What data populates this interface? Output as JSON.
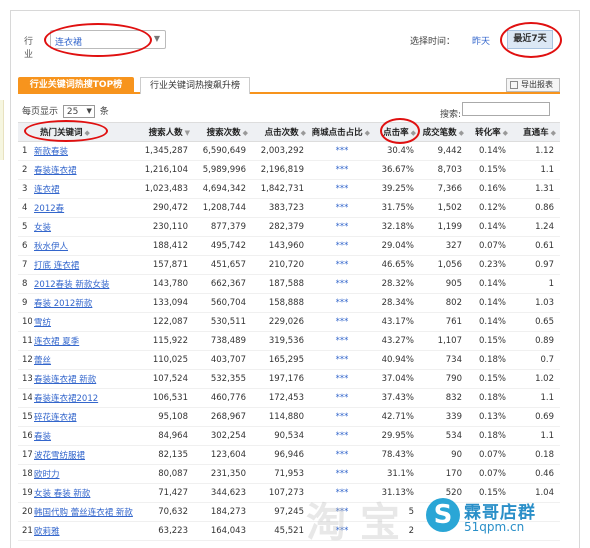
{
  "filter": {
    "industry_label": "行业",
    "industry_value": "连衣裙",
    "time_label": "选择时间：",
    "time_yesterday": "昨天",
    "time_recent": "最近7天"
  },
  "tabs": [
    {
      "label": "行业关键词热搜TOP榜"
    },
    {
      "label": "行业关键词热搜飙升榜"
    }
  ],
  "export_label": "导出报表",
  "pager": {
    "prefix": "每页显示",
    "value": "25",
    "suffix": "条"
  },
  "search": {
    "label": "搜索:",
    "placeholder": ""
  },
  "table": {
    "headers": [
      "热门关键词",
      "搜索人数",
      "搜索次数",
      "点击次数",
      "商城点击占比",
      "点击率",
      "成交笔数",
      "转化率",
      "直通车"
    ],
    "rows": [
      {
        "idx": "1",
        "kw": "新款春装",
        "people": "1,345,287",
        "times": "6,590,649",
        "clicks": "2,003,292",
        "mall": "***",
        "ctr": "30.4%",
        "deals": "9,442",
        "conv": "0.14%",
        "ztc": "1.12"
      },
      {
        "idx": "2",
        "kw": "春装连衣裙",
        "people": "1,216,104",
        "times": "5,989,996",
        "clicks": "2,196,819",
        "mall": "***",
        "ctr": "36.67%",
        "deals": "8,703",
        "conv": "0.15%",
        "ztc": "1.1"
      },
      {
        "idx": "3",
        "kw": "连衣裙",
        "people": "1,023,483",
        "times": "4,694,342",
        "clicks": "1,842,731",
        "mall": "***",
        "ctr": "39.25%",
        "deals": "7,366",
        "conv": "0.16%",
        "ztc": "1.31"
      },
      {
        "idx": "4",
        "kw": "2012春",
        "people": "290,472",
        "times": "1,208,744",
        "clicks": "383,723",
        "mall": "***",
        "ctr": "31.75%",
        "deals": "1,502",
        "conv": "0.12%",
        "ztc": "0.86"
      },
      {
        "idx": "5",
        "kw": "女装",
        "people": "230,110",
        "times": "877,379",
        "clicks": "282,379",
        "mall": "***",
        "ctr": "32.18%",
        "deals": "1,199",
        "conv": "0.14%",
        "ztc": "1.24"
      },
      {
        "idx": "6",
        "kw": "秋水伊人",
        "people": "188,412",
        "times": "495,742",
        "clicks": "143,960",
        "mall": "***",
        "ctr": "29.04%",
        "deals": "327",
        "conv": "0.07%",
        "ztc": "0.61"
      },
      {
        "idx": "7",
        "kw": "打底 连衣裙",
        "people": "157,871",
        "times": "451,657",
        "clicks": "210,720",
        "mall": "***",
        "ctr": "46.65%",
        "deals": "1,056",
        "conv": "0.23%",
        "ztc": "0.97"
      },
      {
        "idx": "8",
        "kw": "2012春装 新款女装",
        "people": "143,780",
        "times": "662,367",
        "clicks": "187,588",
        "mall": "***",
        "ctr": "28.32%",
        "deals": "905",
        "conv": "0.14%",
        "ztc": "1"
      },
      {
        "idx": "9",
        "kw": "春装 2012新款",
        "people": "133,094",
        "times": "560,704",
        "clicks": "158,888",
        "mall": "***",
        "ctr": "28.34%",
        "deals": "802",
        "conv": "0.14%",
        "ztc": "1.03"
      },
      {
        "idx": "10",
        "kw": "雪纺",
        "people": "122,087",
        "times": "530,511",
        "clicks": "229,026",
        "mall": "***",
        "ctr": "43.17%",
        "deals": "761",
        "conv": "0.14%",
        "ztc": "0.65"
      },
      {
        "idx": "11",
        "kw": "连衣裙 夏季",
        "people": "115,922",
        "times": "738,489",
        "clicks": "319,536",
        "mall": "***",
        "ctr": "43.27%",
        "deals": "1,107",
        "conv": "0.15%",
        "ztc": "0.89"
      },
      {
        "idx": "12",
        "kw": "蕾丝",
        "people": "110,025",
        "times": "403,707",
        "clicks": "165,295",
        "mall": "***",
        "ctr": "40.94%",
        "deals": "734",
        "conv": "0.18%",
        "ztc": "0.7"
      },
      {
        "idx": "13",
        "kw": "春装连衣裙 新款",
        "people": "107,524",
        "times": "532,355",
        "clicks": "197,176",
        "mall": "***",
        "ctr": "37.04%",
        "deals": "790",
        "conv": "0.15%",
        "ztc": "1.02"
      },
      {
        "idx": "14",
        "kw": "春装连衣裙2012",
        "people": "106,531",
        "times": "460,776",
        "clicks": "172,453",
        "mall": "***",
        "ctr": "37.43%",
        "deals": "832",
        "conv": "0.18%",
        "ztc": "1.1"
      },
      {
        "idx": "15",
        "kw": "碎花连衣裙",
        "people": "95,108",
        "times": "268,967",
        "clicks": "114,880",
        "mall": "***",
        "ctr": "42.71%",
        "deals": "339",
        "conv": "0.13%",
        "ztc": "0.69"
      },
      {
        "idx": "16",
        "kw": "春装",
        "people": "84,964",
        "times": "302,254",
        "clicks": "90,534",
        "mall": "***",
        "ctr": "29.95%",
        "deals": "534",
        "conv": "0.18%",
        "ztc": "1.1"
      },
      {
        "idx": "17",
        "kw": "波花雪纺服裙",
        "people": "82,135",
        "times": "123,604",
        "clicks": "96,946",
        "mall": "***",
        "ctr": "78.43%",
        "deals": "90",
        "conv": "0.07%",
        "ztc": "0.18"
      },
      {
        "idx": "18",
        "kw": "欧时力",
        "people": "80,087",
        "times": "231,350",
        "clicks": "71,953",
        "mall": "***",
        "ctr": "31.1%",
        "deals": "170",
        "conv": "0.07%",
        "ztc": "0.46"
      },
      {
        "idx": "19",
        "kw": "女装 春装 新款",
        "people": "71,427",
        "times": "344,623",
        "clicks": "107,273",
        "mall": "***",
        "ctr": "31.13%",
        "deals": "520",
        "conv": "0.15%",
        "ztc": "1.04"
      },
      {
        "idx": "20",
        "kw": "韩国代购 蕾丝连衣裙 新款",
        "people": "70,632",
        "times": "184,273",
        "clicks": "97,245",
        "mall": "***",
        "ctr": "5",
        "deals": "",
        "conv": "",
        "ztc": ""
      },
      {
        "idx": "21",
        "kw": "欧莉雅",
        "people": "63,223",
        "times": "164,043",
        "clicks": "45,521",
        "mall": "***",
        "ctr": "2",
        "deals": "",
        "conv": "",
        "ztc": ""
      }
    ]
  },
  "watermark": {
    "logo_letter": "S",
    "name": "霖哥店群",
    "url": "51qpm.cn"
  }
}
